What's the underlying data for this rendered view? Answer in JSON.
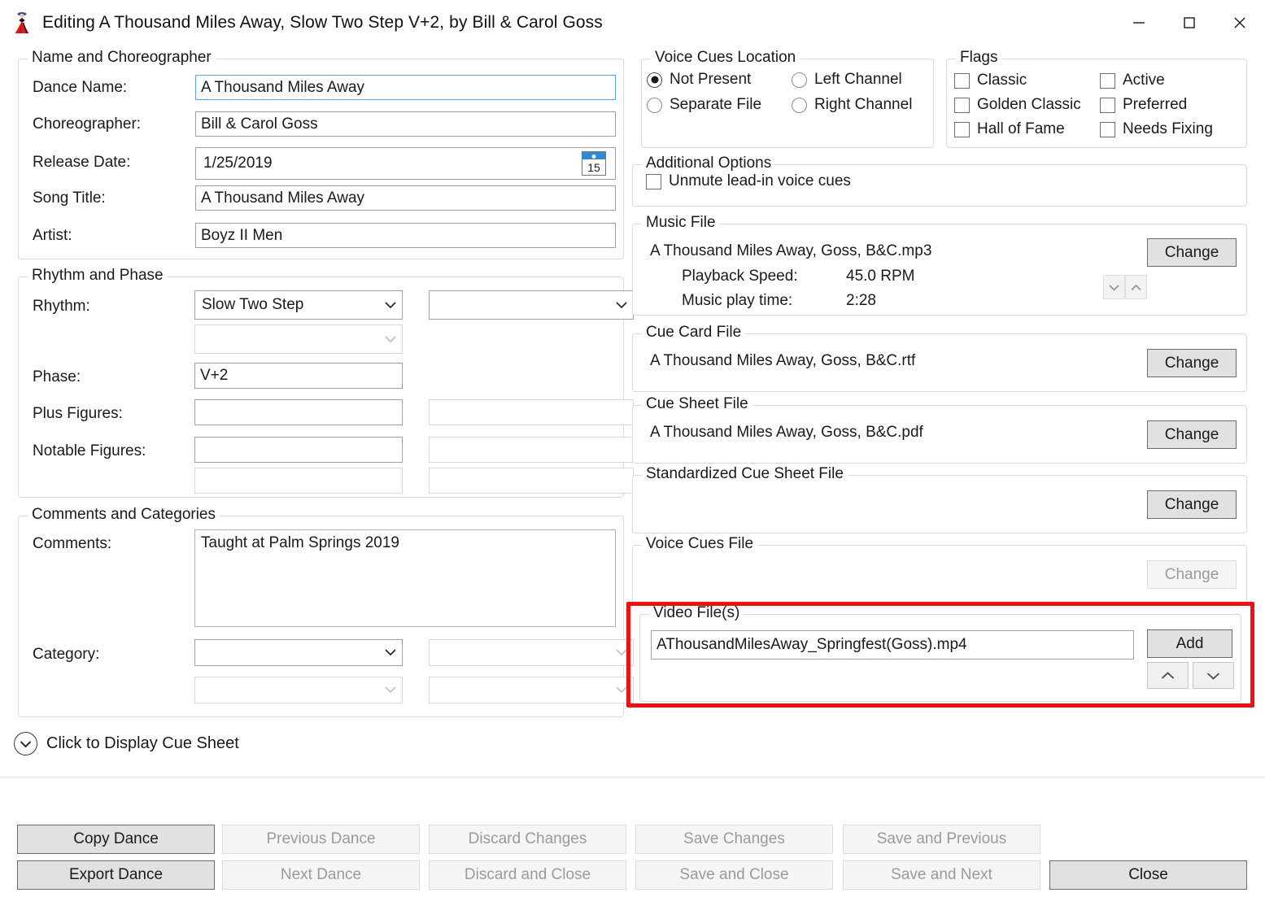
{
  "window": {
    "title": "Editing A Thousand Miles Away, Slow Two Step V+2, by Bill & Carol Goss",
    "icon": "dancer-icon",
    "minimize_label": "Minimize",
    "maximize_label": "Maximize",
    "close_label": "Close"
  },
  "name_group": {
    "legend": "Name and Choreographer",
    "dance_name_label": "Dance Name:",
    "dance_name_value": "A Thousand Miles Away",
    "choreographer_label": "Choreographer:",
    "choreographer_value": "Bill & Carol Goss",
    "release_date_label": "Release Date:",
    "release_date_value": "1/25/2019",
    "date_picker_day": "15",
    "song_title_label": "Song Title:",
    "song_title_value": "A Thousand Miles Away",
    "artist_label": "Artist:",
    "artist_value": "Boyz II Men"
  },
  "rhythm_group": {
    "legend": "Rhythm and Phase",
    "rhythm_label": "Rhythm:",
    "rhythm_value": "Slow Two Step",
    "rhythm_secondary_value": "",
    "rhythm_third_value": "",
    "phase_label": "Phase:",
    "phase_value": "V+2",
    "plus_figures_label": "Plus Figures:",
    "plus_figures_value": "",
    "plus_figures_secondary_value": "",
    "notable_figures_label": "Notable Figures:",
    "notable_figures_value": "",
    "notable_figures_secondary_value": "",
    "notable_figures_row2_value": "",
    "notable_figures_row2_secondary_value": ""
  },
  "comments_group": {
    "legend": "Comments and Categories",
    "comments_label": "Comments:",
    "comments_value": "Taught at Palm Springs 2019",
    "category_label": "Category:",
    "category_1_value": "",
    "category_2_value": "",
    "category_3_value": "",
    "category_4_value": ""
  },
  "expander": {
    "label": "Click to Display Cue Sheet",
    "icon": "chevron-down-circle-icon"
  },
  "voice_cues_location": {
    "legend": "Voice Cues Location",
    "options": [
      {
        "label": "Not Present",
        "selected": true
      },
      {
        "label": "Left Channel",
        "selected": false
      },
      {
        "label": "Separate File",
        "selected": false
      },
      {
        "label": "Right Channel",
        "selected": false
      }
    ]
  },
  "flags": {
    "legend": "Flags",
    "items": [
      {
        "label": "Classic",
        "checked": false
      },
      {
        "label": "Active",
        "checked": false
      },
      {
        "label": "Golden Classic",
        "checked": false
      },
      {
        "label": "Preferred",
        "checked": false
      },
      {
        "label": "Hall of Fame",
        "checked": false
      },
      {
        "label": "Needs Fixing",
        "checked": false
      }
    ]
  },
  "additional_options": {
    "legend": "Additional Options",
    "unmute_label": "Unmute lead-in voice cues",
    "unmute_checked": false
  },
  "music_file": {
    "legend": "Music File",
    "filename": "A Thousand Miles Away, Goss, B&C.mp3",
    "playback_speed_label": "Playback Speed:",
    "playback_speed_value": "45.0 RPM",
    "play_time_label": "Music play time:",
    "play_time_value": "2:28",
    "change_label": "Change",
    "spin_down_icon": "chevron-down-icon",
    "spin_up_icon": "chevron-up-icon"
  },
  "cue_card_file": {
    "legend": "Cue Card File",
    "filename": "A Thousand Miles Away, Goss, B&C.rtf",
    "change_label": "Change"
  },
  "cue_sheet_file": {
    "legend": "Cue Sheet File",
    "filename": "A Thousand Miles Away, Goss, B&C.pdf",
    "change_label": "Change"
  },
  "standardized_cue_sheet_file": {
    "legend": "Standardized Cue Sheet File",
    "filename": "",
    "change_label": "Change"
  },
  "voice_cues_file": {
    "legend": "Voice Cues File",
    "filename": "",
    "change_label": "Change"
  },
  "video_files": {
    "legend": "Video File(s)",
    "selected_file": "AThousandMilesAway_Springfest(Goss).mp4",
    "add_label": "Add",
    "move_up_icon": "chevron-up-icon",
    "move_down_icon": "chevron-down-icon",
    "highlight_color": "#ee1111"
  },
  "bottom_buttons": [
    {
      "label": "Copy Dance",
      "enabled": true
    },
    {
      "label": "Previous Dance",
      "enabled": false
    },
    {
      "label": "Discard Changes",
      "enabled": false
    },
    {
      "label": "Save Changes",
      "enabled": false
    },
    {
      "label": "Save and Previous",
      "enabled": false
    },
    {
      "label": "Export Dance",
      "enabled": true
    },
    {
      "label": "Next Dance",
      "enabled": false
    },
    {
      "label": "Discard and Close",
      "enabled": false
    },
    {
      "label": "Save and Close",
      "enabled": false
    },
    {
      "label": "Save and Next",
      "enabled": false
    },
    {
      "label": "Close",
      "enabled": true
    }
  ]
}
